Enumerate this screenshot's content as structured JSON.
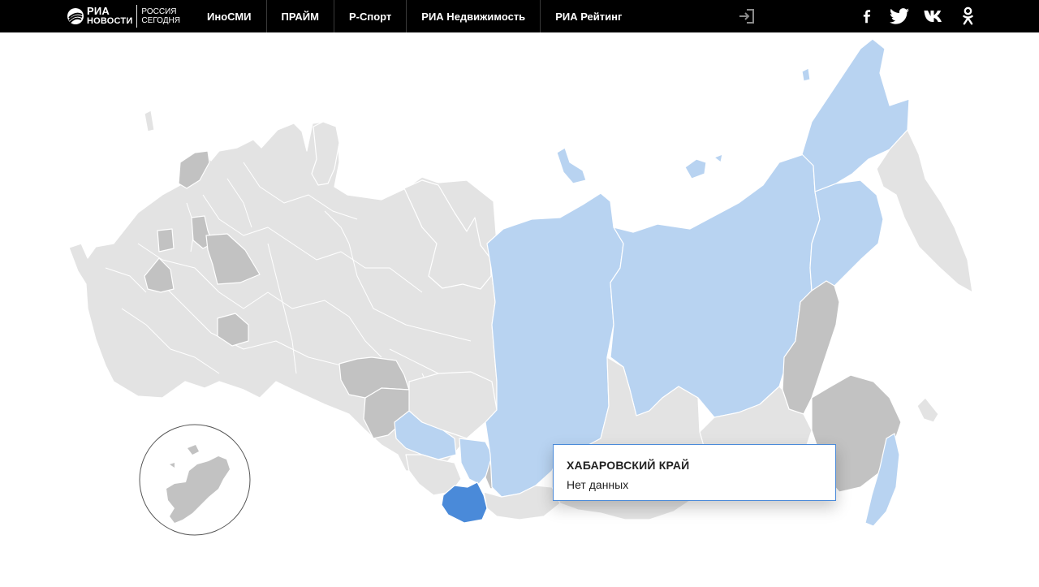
{
  "header": {
    "logo": {
      "ria_line1": "РИА",
      "ria_line2": "НОВОСТИ",
      "rs_line1": "РОССИЯ",
      "rs_line2": "СЕГОДНЯ"
    },
    "nav": [
      {
        "label": "ИноСМИ"
      },
      {
        "label": "ПРАЙМ"
      },
      {
        "label": "Р-Спорт"
      },
      {
        "label": "РИА Недвижимость"
      },
      {
        "label": "РИА Рейтинг"
      }
    ],
    "login_icon": "login-icon",
    "social": [
      {
        "icon": "facebook-icon"
      },
      {
        "icon": "twitter-icon"
      },
      {
        "icon": "vk-icon"
      },
      {
        "icon": "odnoklassniki-icon"
      }
    ]
  },
  "map": {
    "colors": {
      "no_data": "#e3e3e3",
      "group_gray": "#c2c2c2",
      "group_light_blue": "#b8d3f1",
      "selected_blue": "#4a8ad9",
      "border": "#ffffff"
    }
  },
  "tooltip": {
    "region": "ХАБАРОВСКИЙ КРАЙ",
    "value": "Нет данных"
  }
}
